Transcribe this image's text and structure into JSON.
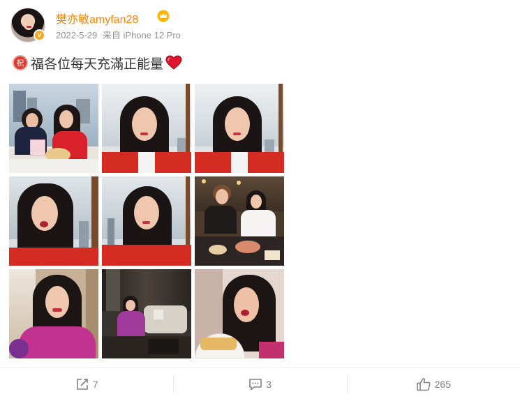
{
  "author": {
    "name": "樊亦敏amyfan28",
    "verified": true,
    "badge_icon": "crown-icon"
  },
  "post": {
    "date": "2022-5-29",
    "source": "来自 iPhone 12 Pro",
    "badge_icon": "blessing-icon",
    "badge_char": "祝",
    "text": "福各位每天充滿正能量",
    "emoji_icon": "heart-icon",
    "image_count": 9
  },
  "actions": {
    "repost_count": "7",
    "comment_count": "3",
    "like_count": "265"
  },
  "colors": {
    "username": "#ff8200",
    "meta": "#939393",
    "action": "#808080",
    "badge": "#d93a2b",
    "verified": "#f5a623"
  }
}
